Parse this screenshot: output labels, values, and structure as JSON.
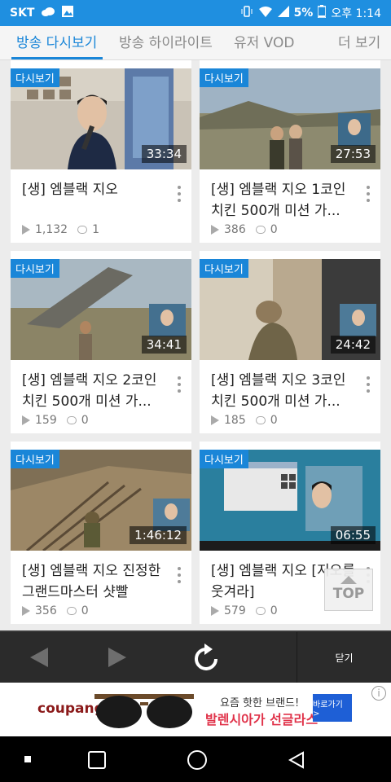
{
  "status_bar": {
    "carrier": "SKT",
    "battery": "5%",
    "time": "오후 1:14",
    "icons": [
      "cloud-icon",
      "image-icon",
      "vibrate-icon",
      "wifi-icon",
      "signal-icon",
      "battery-icon"
    ]
  },
  "tabs": [
    {
      "label": "방송 다시보기",
      "active": true
    },
    {
      "label": "방송 하이라이트",
      "active": false
    },
    {
      "label": "유저 VOD",
      "active": false
    },
    {
      "label": "더 보기",
      "active": false
    }
  ],
  "cards": [
    {
      "badge": "다시보기",
      "duration": "33:34",
      "title": "[생] 엠블랙 지오",
      "views": "1,132",
      "comments": "1"
    },
    {
      "badge": "다시보기",
      "duration": "27:53",
      "title": "[생] 엠블랙 지오 1코인 치킨 500개 미션 가...",
      "views": "386",
      "comments": "0"
    },
    {
      "badge": "다시보기",
      "duration": "34:41",
      "title": "[생] 엠블랙 지오 2코인 치킨 500개 미션 가...",
      "views": "159",
      "comments": "0"
    },
    {
      "badge": "다시보기",
      "duration": "24:42",
      "title": "[생] 엠블랙 지오 3코인 치킨 500개 미션 가...",
      "views": "185",
      "comments": "0"
    },
    {
      "badge": "다시보기",
      "duration": "1:46:12",
      "title": "[생] 엠블랙 지오 진정한 그랜드마스터 샷빨",
      "views": "356",
      "comments": "0"
    },
    {
      "badge": "다시보기",
      "duration": "06:55",
      "title": "[생] 엠블랙 지오 [지오를 웃겨라]",
      "views": "579",
      "comments": "0"
    }
  ],
  "top_button": {
    "label": "TOP"
  },
  "toolbar": {
    "close_label": "닫기"
  },
  "ad": {
    "brand": "coupang",
    "line1": "요즘 핫한 브랜드!",
    "line2": "발렌시아가 선글라스",
    "cta": "바로가기 >",
    "info": "i"
  },
  "colors": {
    "accent": "#1a86d8",
    "status_bar": "#1f8fe0",
    "toolbar": "#2b2b2b"
  }
}
